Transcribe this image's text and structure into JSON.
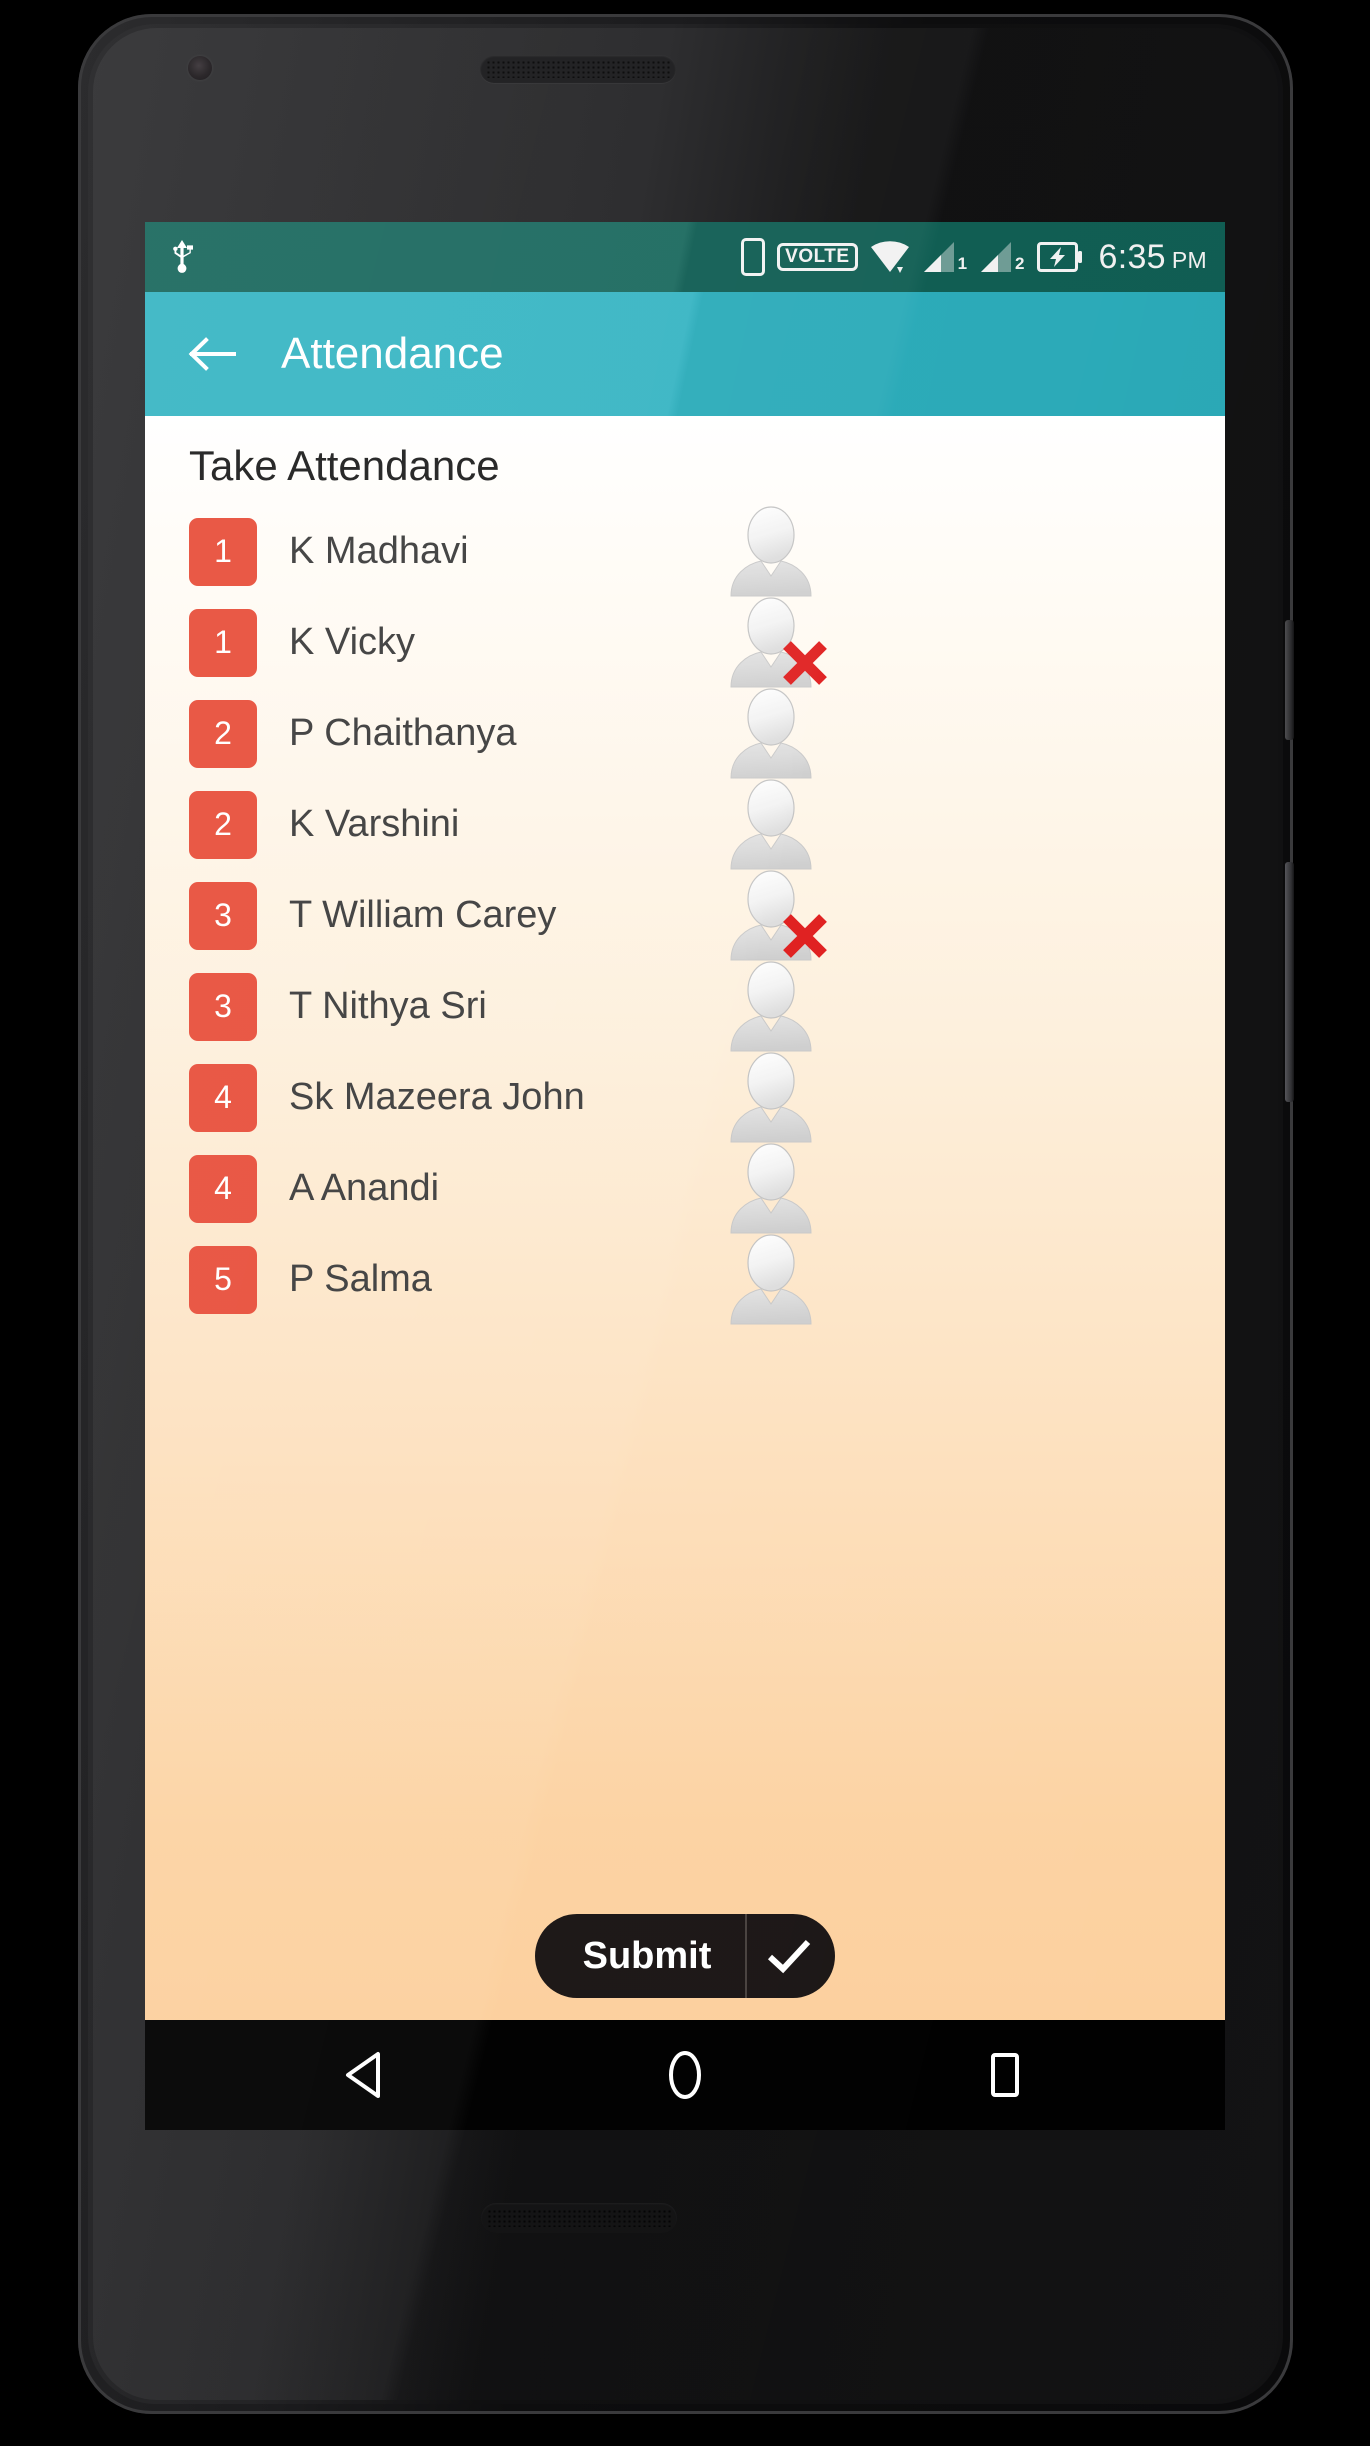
{
  "status_bar": {
    "usb_icon": "usb-icon",
    "vibrate_icon": "vibrate-icon",
    "volte_label": "VOLTE",
    "wifi_icon": "wifi-icon",
    "sim1_label": "1",
    "sim2_label": "2",
    "battery_icon": "battery-charging-icon",
    "time": "6:35",
    "ampm": "PM"
  },
  "app_bar": {
    "back_icon": "arrow-back-icon",
    "title": "Attendance",
    "background_color": "#2CB1C0"
  },
  "content": {
    "section_title": "Take Attendance",
    "badge_color": "#E8503C",
    "absent_mark_color": "#E02020",
    "students": [
      {
        "badge": "1",
        "name": "K Madhavi",
        "status": "present"
      },
      {
        "badge": "1",
        "name": "K Vicky",
        "status": "absent"
      },
      {
        "badge": "2",
        "name": "P Chaithanya",
        "status": "present"
      },
      {
        "badge": "2",
        "name": "K Varshini",
        "status": "present"
      },
      {
        "badge": "3",
        "name": "T William Carey",
        "status": "absent"
      },
      {
        "badge": "3",
        "name": "T Nithya Sri",
        "status": "present"
      },
      {
        "badge": "4",
        "name": "Sk Mazeera John",
        "status": "present"
      },
      {
        "badge": "4",
        "name": "A Anandi",
        "status": "present"
      },
      {
        "badge": "5",
        "name": "P Salma",
        "status": "present"
      }
    ]
  },
  "submit": {
    "label": "Submit",
    "check_icon": "check-icon"
  },
  "nav_bar": {
    "back_icon": "triangle-back-icon",
    "home_icon": "circle-home-icon",
    "recents_icon": "square-recents-icon"
  }
}
